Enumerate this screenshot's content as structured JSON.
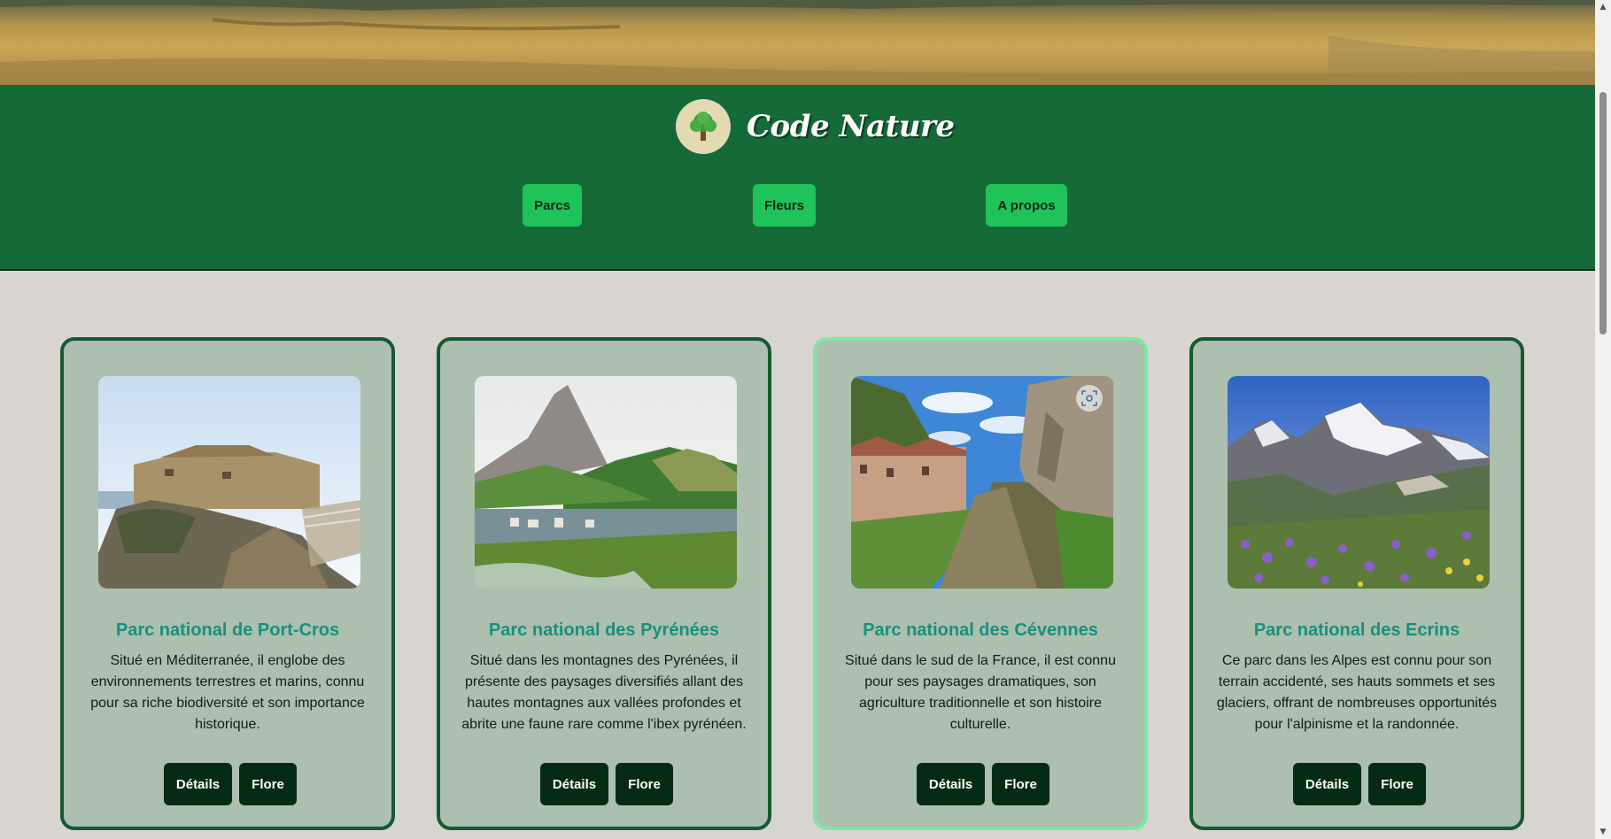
{
  "site": {
    "brand_name": "Code Nature",
    "logo_icon": "tree-icon"
  },
  "nav": {
    "items": [
      {
        "label": "Parcs"
      },
      {
        "label": "Fleurs"
      },
      {
        "label": "A propos"
      }
    ]
  },
  "cards": [
    {
      "title": "Parc national de Port-Cros",
      "description": "Situé en Méditerranée, il englobe des environnements terrestres et marins, connu pour sa riche biodiversité et son importance historique.",
      "details_label": "Détails",
      "flore_label": "Flore"
    },
    {
      "title": "Parc national des Pyrénées",
      "description": "Situé dans les montagnes des Pyrénées, il présente des paysages diversifiés allant des hautes montagnes aux vallées profondes et abrite une faune rare comme l'ibex pyrénéen.",
      "details_label": "Détails",
      "flore_label": "Flore"
    },
    {
      "title": "Parc national des Cévennes",
      "description": "Situé dans le sud de la France, il est connu pour ses paysages dramatiques, son agriculture traditionnelle et son histoire culturelle.",
      "details_label": "Détails",
      "flore_label": "Flore"
    },
    {
      "title": "Parc national des Ecrins",
      "description": "Ce parc dans les Alpes est connu pour son terrain accidenté, ses hauts sommets et ses glaciers, offrant de nombreuses opportunités pour l'alpinisme et la randonnée.",
      "details_label": "Détails",
      "flore_label": "Flore"
    }
  ],
  "colors": {
    "header_bg": "#166a37",
    "nav_button": "#20c25a",
    "card_bg": "#adbfae",
    "card_title": "#17907e",
    "card_button": "#062b14",
    "page_bg": "#d8d5d1"
  }
}
